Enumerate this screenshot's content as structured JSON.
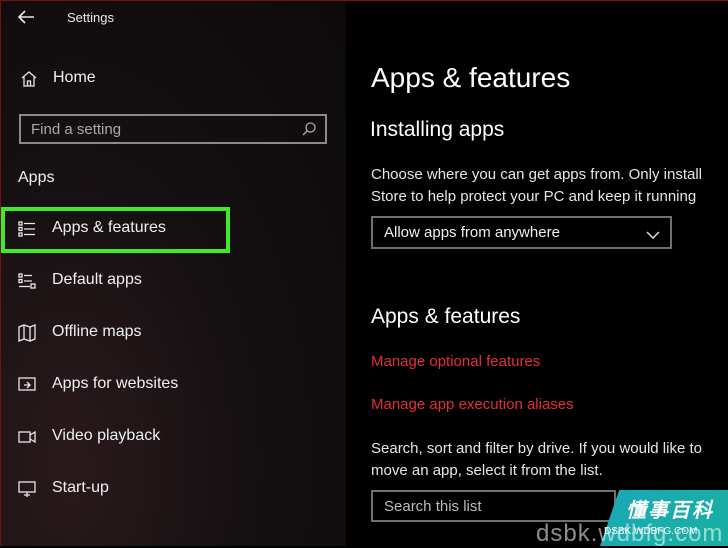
{
  "window": {
    "title": "Settings"
  },
  "sidebar": {
    "home_label": "Home",
    "search_placeholder": "Find a setting",
    "section_label": "Apps",
    "items": [
      {
        "label": "Apps & features",
        "icon": "apps-features-icon",
        "selected": true
      },
      {
        "label": "Default apps",
        "icon": "default-apps-icon"
      },
      {
        "label": "Offline maps",
        "icon": "offline-maps-icon"
      },
      {
        "label": "Apps for websites",
        "icon": "apps-for-websites-icon"
      },
      {
        "label": "Video playback",
        "icon": "video-playback-icon"
      },
      {
        "label": "Start-up",
        "icon": "startup-icon"
      }
    ]
  },
  "main": {
    "page_title": "Apps & features",
    "installing_heading": "Installing apps",
    "installing_text_line1": "Choose where you can get apps from. Only install",
    "installing_text_line2": "Store to help protect your PC and keep it running",
    "install_source_value": "Allow apps from anywhere",
    "apps_heading": "Apps & features",
    "link_optional_features": "Manage optional features",
    "link_execution_aliases": "Manage app execution aliases",
    "search_text_line1": "Search, sort and filter by drive. If you would like to",
    "search_text_line2": "move an app, select it from the list.",
    "list_search_placeholder": "Search this list"
  },
  "watermark": {
    "cn": "懂事百科",
    "domain_small": "DSBK.WDBFG.COM",
    "domain_large": "dsbk.wdbfg.com"
  },
  "colors": {
    "accent_link": "#e0303a",
    "highlight": "#41e82b",
    "background": "#000000"
  }
}
